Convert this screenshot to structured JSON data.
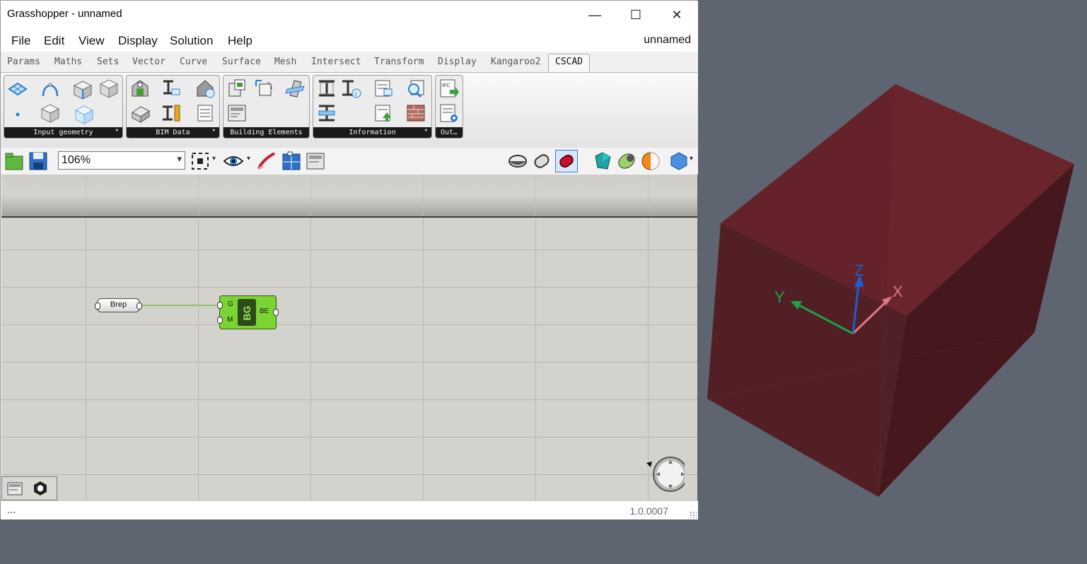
{
  "window": {
    "title": "Grasshopper - unnamed",
    "minimize_glyph": "—",
    "maximize_glyph": "☐",
    "close_glyph": "✕"
  },
  "menu": {
    "items": [
      "File",
      "Edit",
      "View",
      "Display",
      "Solution",
      "Help"
    ],
    "doc_name": "unnamed"
  },
  "tabs": {
    "items": [
      "Params",
      "Maths",
      "Sets",
      "Vector",
      "Curve",
      "Surface",
      "Mesh",
      "Intersect",
      "Transform",
      "Display",
      "Kangaroo2",
      "CSCAD"
    ],
    "active": "CSCAD"
  },
  "ribbon": {
    "panels": [
      "Input geometry",
      "BIM Data",
      "Building Elements",
      "Information",
      "Out…"
    ],
    "panel_arrow": "▾"
  },
  "toolbar": {
    "zoom": "106%",
    "zoom_arrow": "▾",
    "dropdown_glyph": "▾"
  },
  "canvas": {
    "param_node": {
      "label": "Brep"
    },
    "component_node": {
      "nickname": "BG",
      "inputs": [
        "G",
        "M"
      ],
      "outputs": [
        "BE"
      ],
      "fill_color": "#7cd432"
    },
    "wire_color": "#8fc26a"
  },
  "status": {
    "left_text": "...",
    "version": "1.0.0007"
  },
  "viewport": {
    "background": "#5f6570",
    "box_color": "#6b2229",
    "axes": {
      "x": {
        "label": "X",
        "color": "#d87b80"
      },
      "y": {
        "label": "Y",
        "color": "#1aa34a"
      },
      "z": {
        "label": "Z",
        "color": "#1a5fd0"
      }
    }
  }
}
